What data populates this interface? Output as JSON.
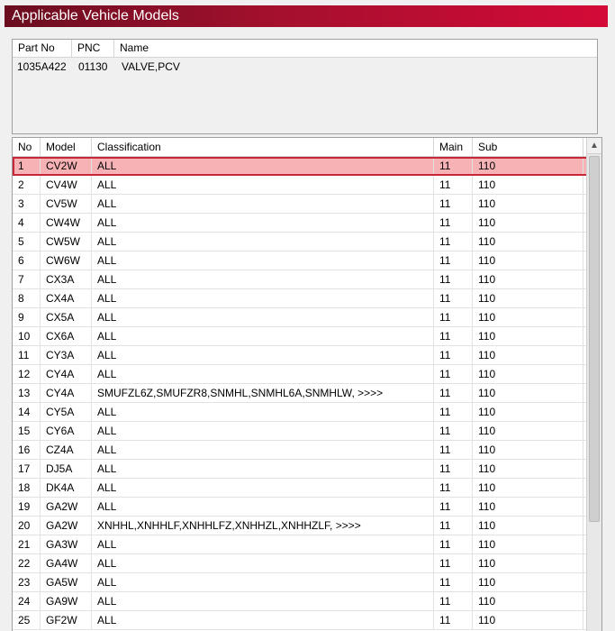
{
  "window": {
    "title": "Applicable Vehicle Models"
  },
  "part_header": {
    "col_part_no": "Part No",
    "col_pnc": "PNC",
    "col_name": "Name"
  },
  "part": {
    "part_no": "1035A422",
    "pnc": "01130",
    "name": "VALVE,PCV"
  },
  "grid_header": {
    "no": "No",
    "model": "Model",
    "classification": "Classification",
    "main": "Main",
    "sub": "Sub"
  },
  "rows": [
    {
      "no": "1",
      "model": "CV2W",
      "classification": "ALL",
      "main": "11",
      "sub": "110"
    },
    {
      "no": "2",
      "model": "CV4W",
      "classification": "ALL",
      "main": "11",
      "sub": "110"
    },
    {
      "no": "3",
      "model": "CV5W",
      "classification": "ALL",
      "main": "11",
      "sub": "110"
    },
    {
      "no": "4",
      "model": "CW4W",
      "classification": "ALL",
      "main": "11",
      "sub": "110"
    },
    {
      "no": "5",
      "model": "CW5W",
      "classification": "ALL",
      "main": "11",
      "sub": "110"
    },
    {
      "no": "6",
      "model": "CW6W",
      "classification": "ALL",
      "main": "11",
      "sub": "110"
    },
    {
      "no": "7",
      "model": "CX3A",
      "classification": "ALL",
      "main": "11",
      "sub": "110"
    },
    {
      "no": "8",
      "model": "CX4A",
      "classification": "ALL",
      "main": "11",
      "sub": "110"
    },
    {
      "no": "9",
      "model": "CX5A",
      "classification": "ALL",
      "main": "11",
      "sub": "110"
    },
    {
      "no": "10",
      "model": "CX6A",
      "classification": "ALL",
      "main": "11",
      "sub": "110"
    },
    {
      "no": "11",
      "model": "CY3A",
      "classification": "ALL",
      "main": "11",
      "sub": "110"
    },
    {
      "no": "12",
      "model": "CY4A",
      "classification": "ALL",
      "main": "11",
      "sub": "110"
    },
    {
      "no": "13",
      "model": "CY4A",
      "classification": "SMUFZL6Z,SMUFZR8,SNMHL,SNMHL6A,SNMHLW,  >>>>",
      "main": "11",
      "sub": "110"
    },
    {
      "no": "14",
      "model": "CY5A",
      "classification": "ALL",
      "main": "11",
      "sub": "110"
    },
    {
      "no": "15",
      "model": "CY6A",
      "classification": "ALL",
      "main": "11",
      "sub": "110"
    },
    {
      "no": "16",
      "model": "CZ4A",
      "classification": "ALL",
      "main": "11",
      "sub": "110"
    },
    {
      "no": "17",
      "model": "DJ5A",
      "classification": "ALL",
      "main": "11",
      "sub": "110"
    },
    {
      "no": "18",
      "model": "DK4A",
      "classification": "ALL",
      "main": "11",
      "sub": "110"
    },
    {
      "no": "19",
      "model": "GA2W",
      "classification": "ALL",
      "main": "11",
      "sub": "110"
    },
    {
      "no": "20",
      "model": "GA2W",
      "classification": "XNHHL,XNHHLF,XNHHLFZ,XNHHZL,XNHHZLF,  >>>>",
      "main": "11",
      "sub": "110"
    },
    {
      "no": "21",
      "model": "GA3W",
      "classification": "ALL",
      "main": "11",
      "sub": "110"
    },
    {
      "no": "22",
      "model": "GA4W",
      "classification": "ALL",
      "main": "11",
      "sub": "110"
    },
    {
      "no": "23",
      "model": "GA5W",
      "classification": "ALL",
      "main": "11",
      "sub": "110"
    },
    {
      "no": "24",
      "model": "GA9W",
      "classification": "ALL",
      "main": "11",
      "sub": "110"
    },
    {
      "no": "25",
      "model": "GF2W",
      "classification": "ALL",
      "main": "11",
      "sub": "110"
    }
  ],
  "selected_row": "1",
  "colors": {
    "title_gradient_start": "#6a0d1f",
    "title_gradient_end": "#d40a37",
    "selected_fill": "#f7b2b6",
    "selected_border": "#c6283a"
  },
  "icons": {
    "scroll_up": "chevron-up-icon"
  }
}
